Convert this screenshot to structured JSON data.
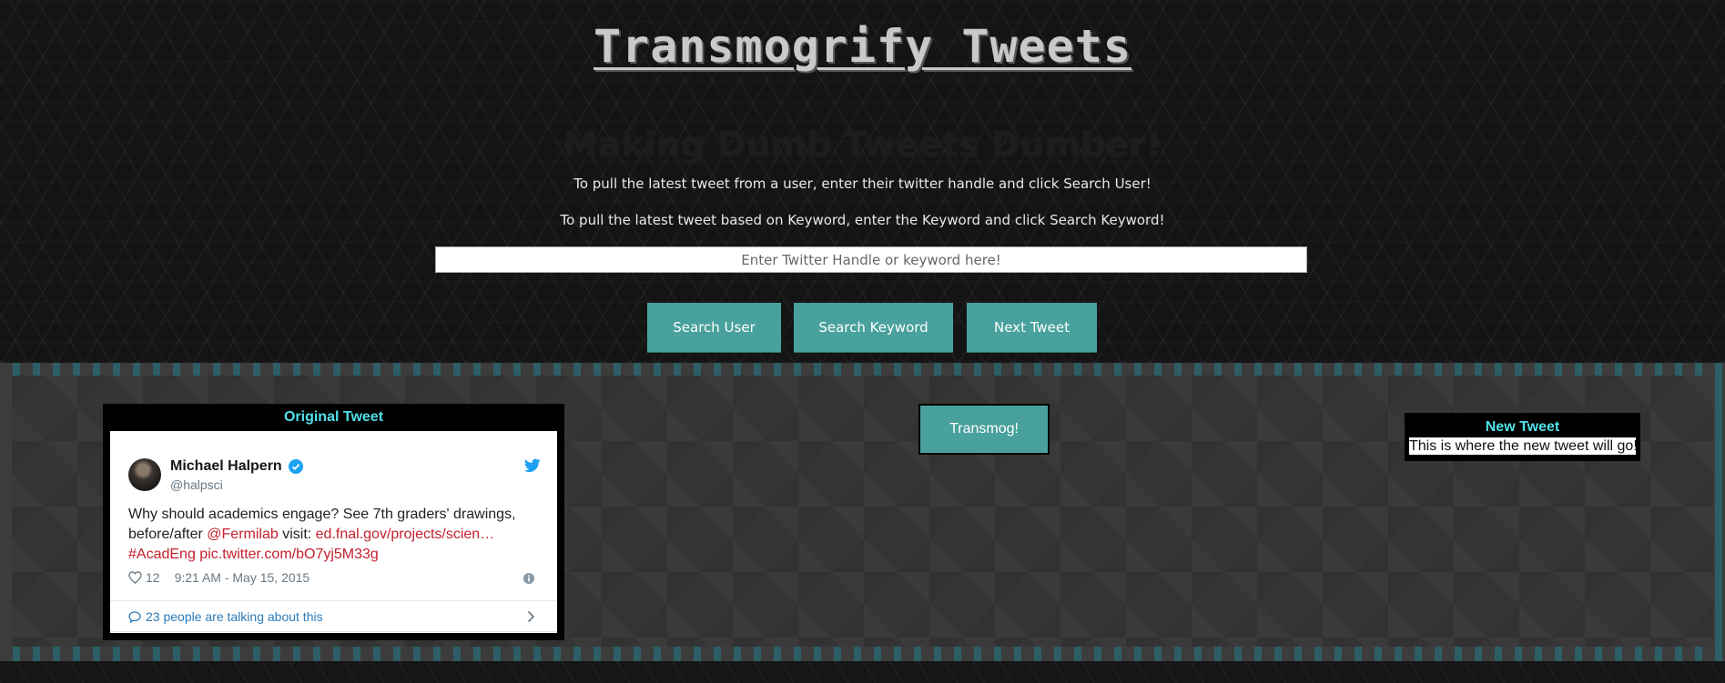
{
  "header": {
    "title": "Transmogrify Tweets",
    "subtitle": "Making Dumb Tweets Dumber!",
    "instruction_user": "To pull the latest tweet from a user, enter their twitter handle and click Search User!",
    "instruction_keyword": "To pull the latest tweet based on Keyword, enter the Keyword and click Search Keyword!"
  },
  "search": {
    "value": "",
    "placeholder": "Enter Twitter Handle or keyword here!"
  },
  "buttons": {
    "search_user": "Search User",
    "search_keyword": "Search Keyword",
    "next_tweet": "Next Tweet",
    "transmog": "Transmog!"
  },
  "original_tweet": {
    "heading": "Original Tweet",
    "author_name": "Michael Halpern",
    "author_handle": "@halpsci",
    "text_part1": "Why should academics engage? See 7th graders' drawings, before/after ",
    "mention": "@Fermilab",
    "text_part2": " visit: ",
    "link1": "ed.fnal.gov/projects/scien…",
    "hashtag": "#AcadEng",
    "link2": "pic.twitter.com/bO7yj5M33g",
    "likes": "12",
    "timestamp": "9:21 AM - May 15, 2015",
    "talking": "23 people are talking about this",
    "icons": [
      "verified-icon",
      "twitter-icon",
      "heart-icon",
      "info-icon",
      "speech-icon",
      "chevron-right-icon"
    ]
  },
  "new_tweet": {
    "heading": "New Tweet",
    "body": "This is where the new tweet will go!"
  },
  "colors": {
    "accent": "#48a19c",
    "heading_cyan": "#4fe0e8",
    "link_red": "#c4202d",
    "twitter_blue": "#1da1f2"
  }
}
